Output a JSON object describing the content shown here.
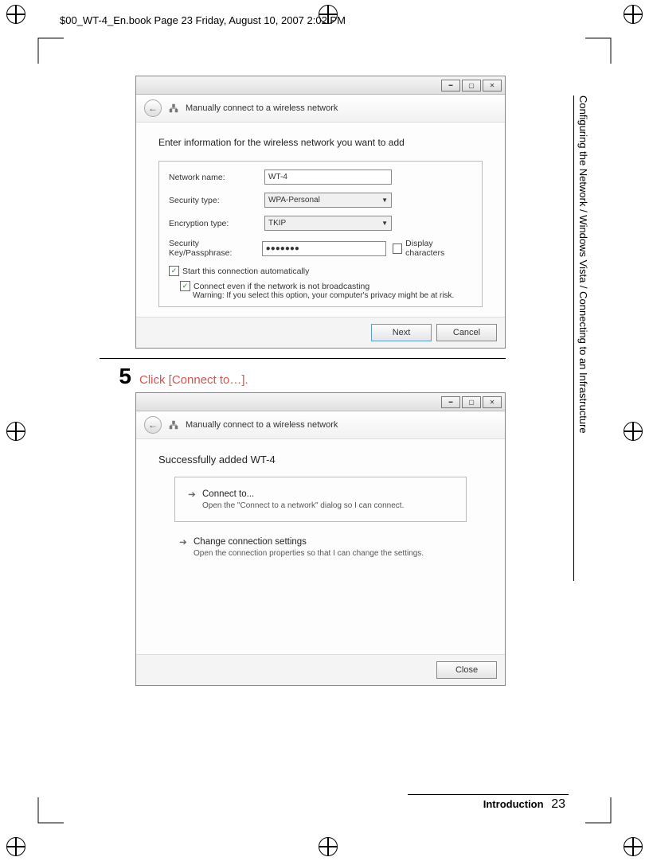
{
  "book_header": "$00_WT-4_En.book  Page 23  Friday, August 10, 2007  2:02 PM",
  "side_label": "Configuring the Network / Windows Vista / Connecting to an Infrastructure",
  "footer_section": "Introduction",
  "page_number": "23",
  "step": {
    "num": "5",
    "text": "Click [Connect to…]."
  },
  "win1": {
    "title": "Manually connect to a wireless network",
    "prompt": "Enter information for the wireless network you want to add",
    "labels": {
      "network_name": "Network name:",
      "security_type": "Security type:",
      "encryption_type": "Encryption type:",
      "passphrase": "Security Key/Passphrase:"
    },
    "values": {
      "network_name": "WT-4",
      "security_type": "WPA-Personal",
      "encryption_type": "TKIP",
      "passphrase": "●●●●●●●"
    },
    "display_characters": "Display characters",
    "start_auto": "Start this connection automatically",
    "connect_hidden": "Connect even if the network is not broadcasting",
    "warning": "Warning: If you select this option, your computer's privacy might be at risk.",
    "next": "Next",
    "cancel": "Cancel"
  },
  "win2": {
    "title": "Manually connect to a wireless network",
    "success": "Successfully added WT-4",
    "opt1": {
      "title": "Connect to...",
      "desc": "Open the \"Connect to a network\" dialog so I can connect."
    },
    "opt2": {
      "title": "Change connection settings",
      "desc": "Open the connection properties so that I can change the settings."
    },
    "close": "Close"
  }
}
